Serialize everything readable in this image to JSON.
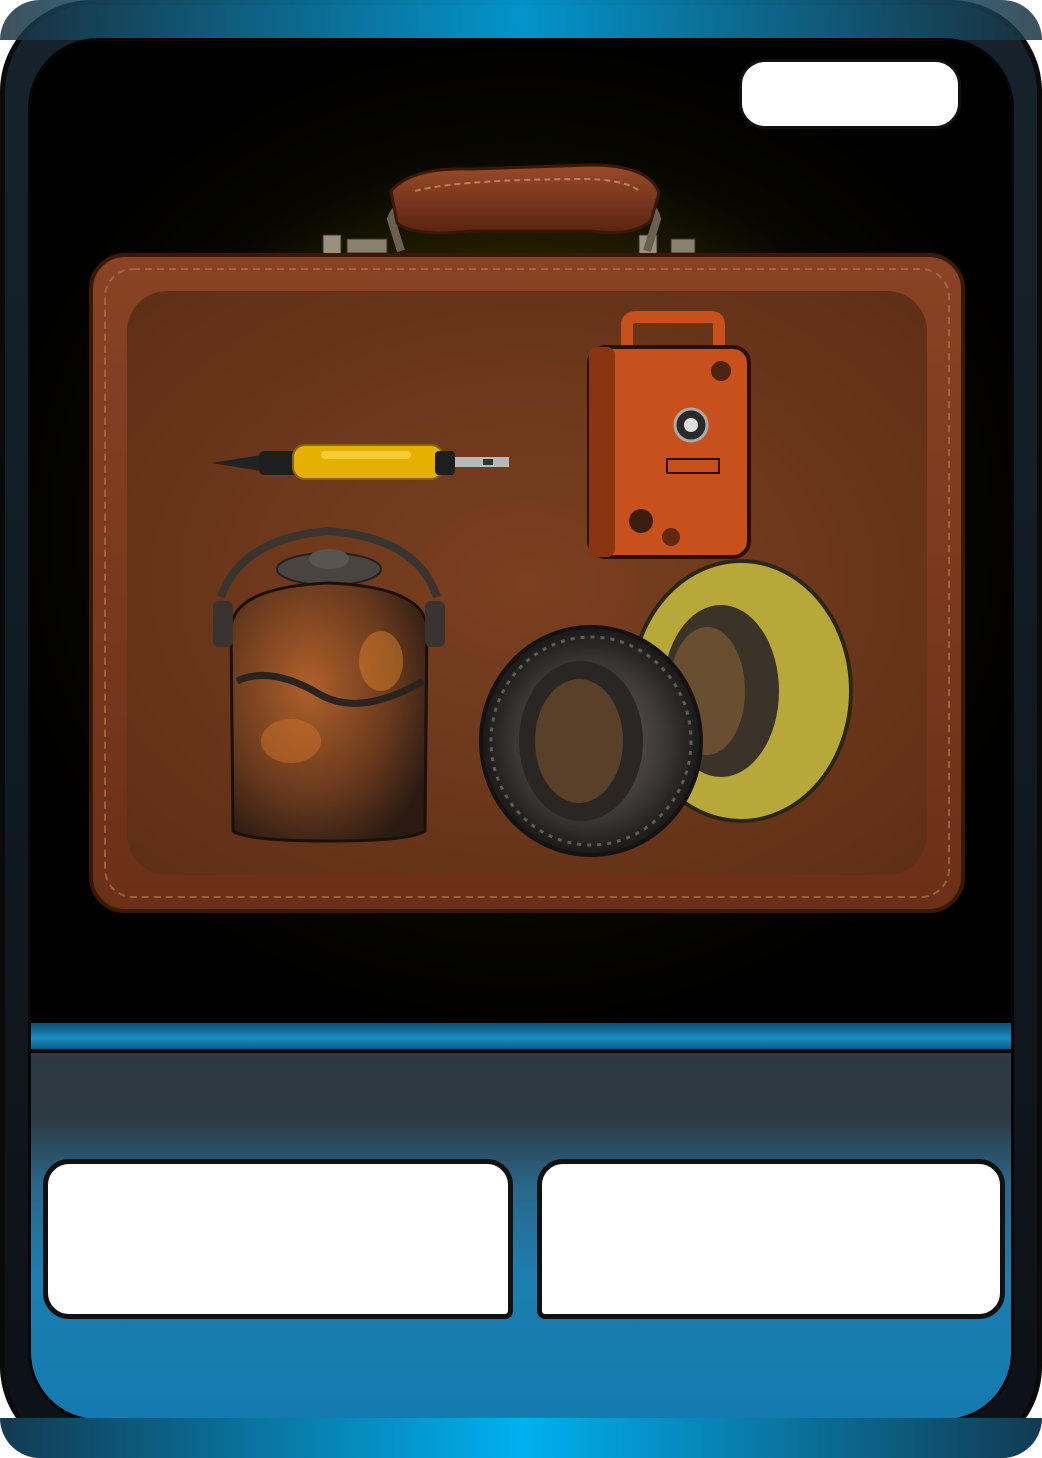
{
  "card": {
    "title": "",
    "left_stat": "",
    "right_stat": ""
  },
  "artwork": {
    "subject": "briefcase",
    "items": [
      "screwdriver-icon",
      "fuel-can-icon",
      "rusty-pot-icon",
      "tires-icon"
    ]
  },
  "colors": {
    "frame_accent": "#00a8e8",
    "briefcase": "#7a3a1c",
    "glow": "#5a5400"
  }
}
